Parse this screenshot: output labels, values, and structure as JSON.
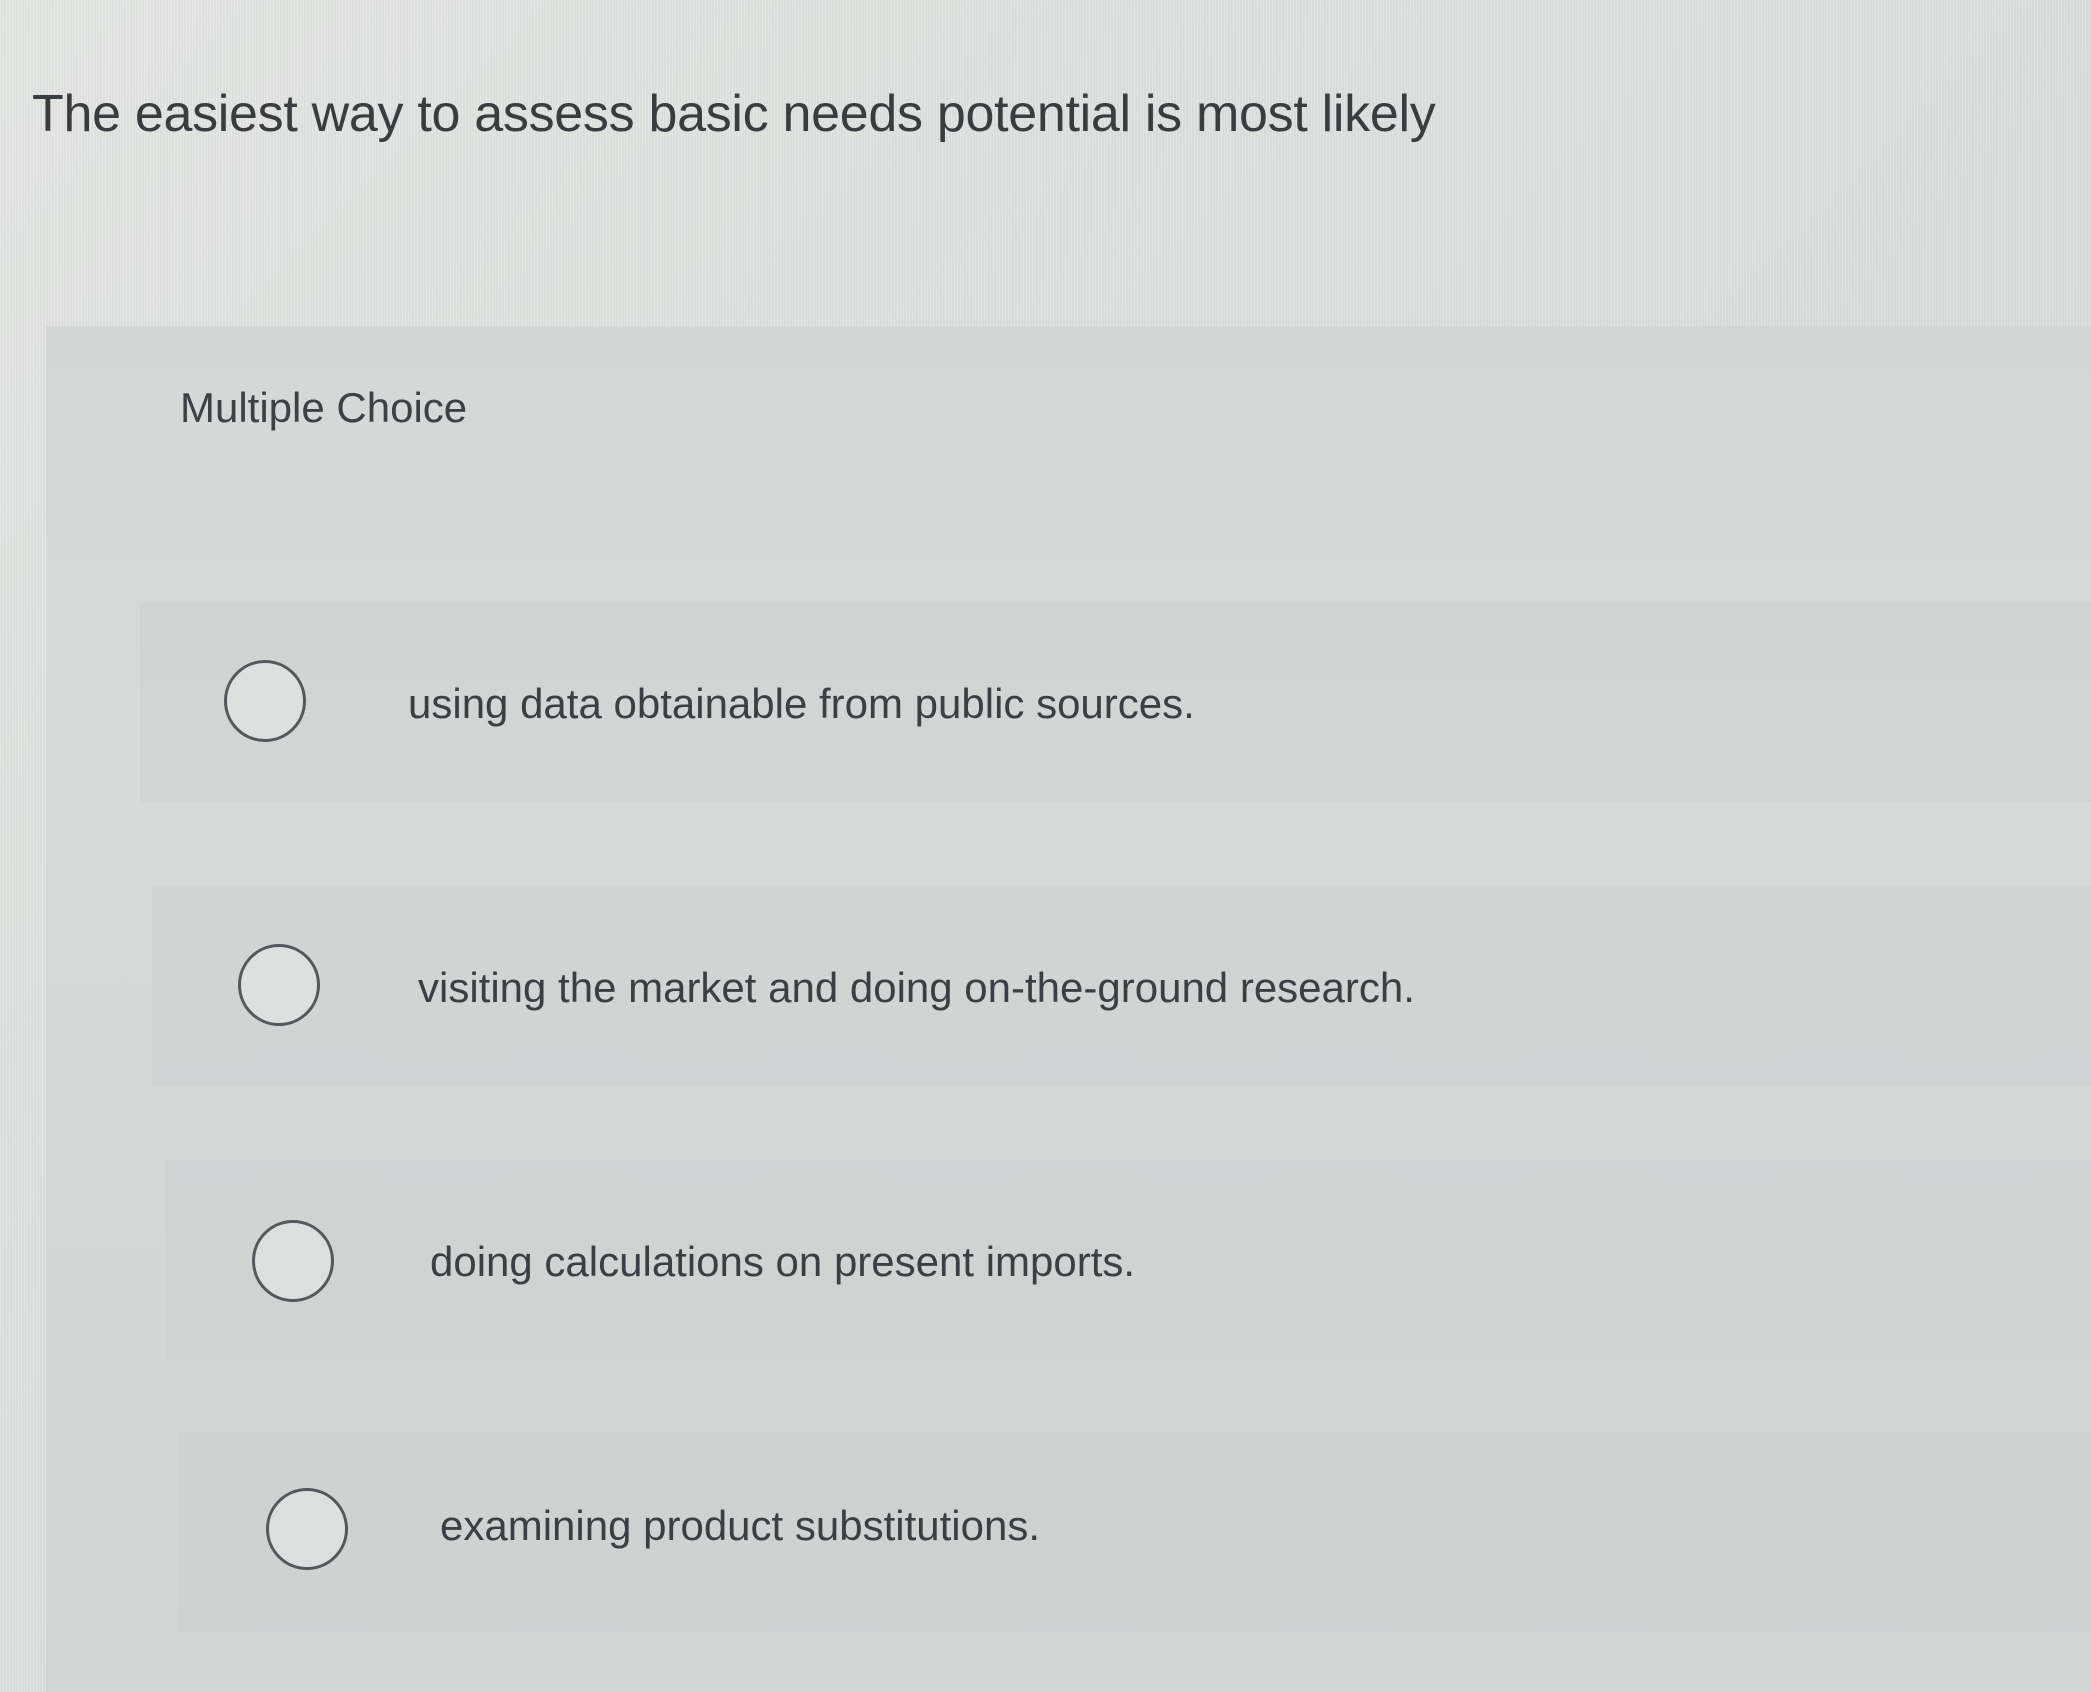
{
  "question": {
    "text": "The easiest way to assess basic needs potential is most likely"
  },
  "answer_panel": {
    "label": "Multiple Choice",
    "choices": [
      {
        "label": "using data obtainable from public sources.",
        "selected": false
      },
      {
        "label": "visiting the market and doing on-the-ground research.",
        "selected": false
      },
      {
        "label": "doing calculations on present imports.",
        "selected": false
      },
      {
        "label": "examining product substitutions.",
        "selected": false
      }
    ]
  }
}
